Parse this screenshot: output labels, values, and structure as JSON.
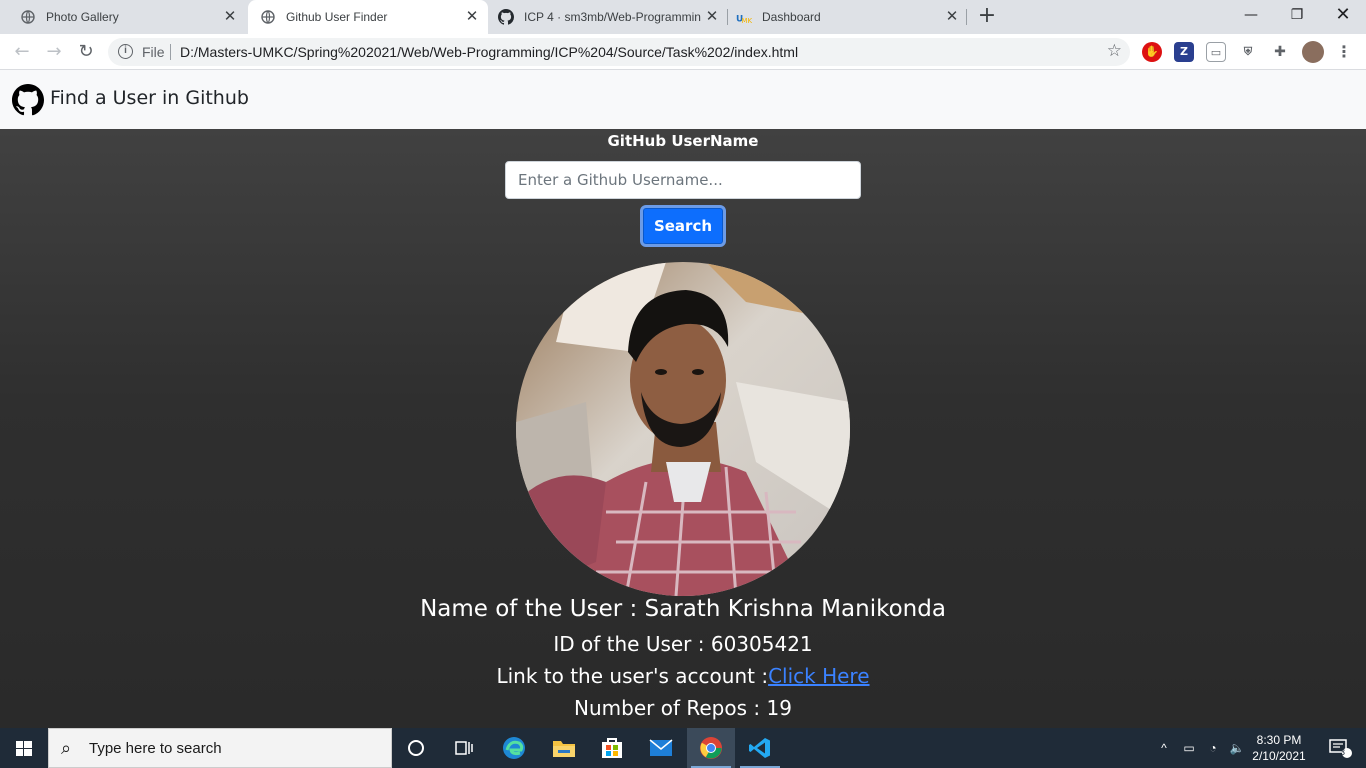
{
  "browser": {
    "tabs": [
      {
        "label": "Photo Gallery",
        "icon": "globe-icon"
      },
      {
        "label": "Github User Finder",
        "icon": "globe-icon"
      },
      {
        "label": "ICP 4 · sm3mb/Web-Programmin",
        "icon": "github-icon"
      },
      {
        "label": "Dashboard",
        "icon": "umkc-icon"
      }
    ],
    "active_tab": 1,
    "address": {
      "scheme_label": "File",
      "url": "D:/Masters-UMKC/Spring%202021/Web/Web-Programming/ICP%204/Source/Task%202/index.html"
    },
    "window_controls": [
      "minimize",
      "restore",
      "close"
    ]
  },
  "page": {
    "brand": "Find a User in Github",
    "search": {
      "label": "GitHub UserName",
      "placeholder": "Enter a Github Username...",
      "button": "Search"
    },
    "user": {
      "name_line": "Name of the User : Sarath Krishna Manikonda",
      "id_line": "ID of the User : 60305421",
      "link_prefix": "Link to the user's account :",
      "link_text": "Click Here",
      "repos_line": "Number of Repos : 19"
    },
    "colors": {
      "accent": "#0d6efd",
      "link": "#3b82ff"
    }
  },
  "taskbar": {
    "search_placeholder": "Type here to search",
    "time": "8:30 PM",
    "date": "2/10/2021",
    "notification_count": "3"
  }
}
